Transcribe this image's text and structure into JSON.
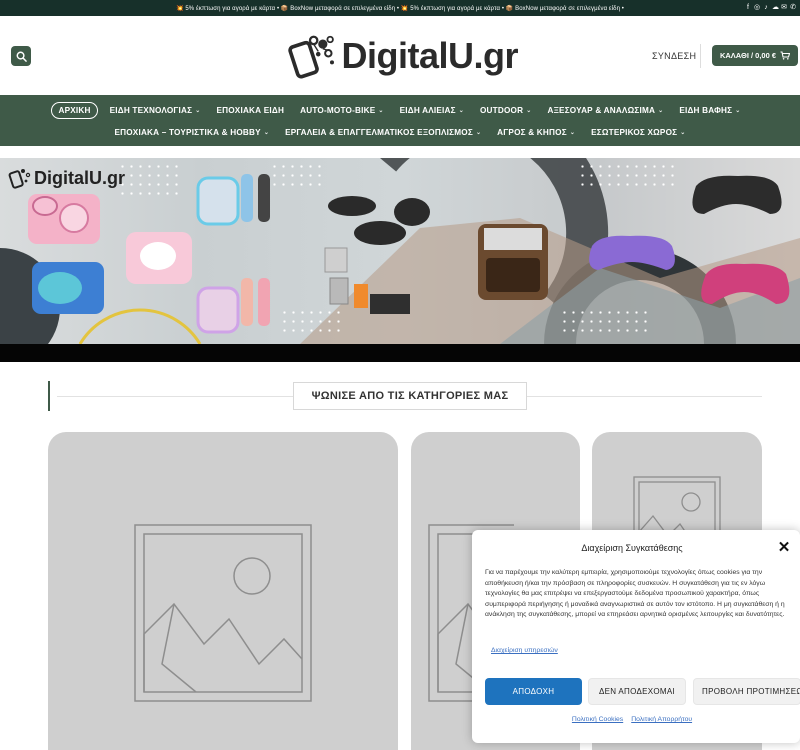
{
  "topbar": {
    "promo": "💥 5% έκπτωση για αγορά με κάρτα • 📦 BoxNow μεταφορά σε επιλεγμένα είδη • 💥 5% έκπτωση για αγορά με κάρτα • 📦 BoxNow μεταφορά σε επιλεγμένα είδη •",
    "social_icons": [
      "facebook-icon",
      "instagram-icon",
      "tiktok-icon",
      "messenger-icon",
      "email-icon",
      "phone-icon"
    ]
  },
  "header": {
    "logo_text": "DigitalU.gr",
    "login_label": "ΣΥΝΔΕΣΗ",
    "cart_label": "ΚΑΛΑΘΙ / 0,00 €"
  },
  "nav": {
    "row1": [
      {
        "label": "ΑΡΧΙΚΗ",
        "active": true,
        "dropdown": false
      },
      {
        "label": "ΕΙΔΗ ΤΕΧΝΟΛΟΓΙΑΣ",
        "dropdown": true
      },
      {
        "label": "ΕΠΟΧΙΑΚΑ ΕΙΔΗ",
        "dropdown": false
      },
      {
        "label": "AUTO-MOTO-BIKE",
        "dropdown": true
      },
      {
        "label": "ΕΙΔΗ ΑΛΙΕΙΑΣ",
        "dropdown": true
      },
      {
        "label": "OUTDOOR",
        "dropdown": true
      },
      {
        "label": "ΑΞΕΣΟΥΑΡ & ΑΝΑΛΩΣΙΜΑ",
        "dropdown": true
      },
      {
        "label": "ΕΙΔΗ ΒΑΦΗΣ",
        "dropdown": true
      }
    ],
    "row2": [
      {
        "label": "ΕΠΟΧΙΑΚΑ – ΤΟΥΡΙΣΤΙΚΑ & HOBBY",
        "dropdown": true
      },
      {
        "label": "ΕΡΓΑΛΕΙΑ & ΕΠΑΓΓΕΛΜΑΤΙΚΟΣ ΕΞΟΠΛΙΣΜΟΣ",
        "dropdown": true
      },
      {
        "label": "ΑΓΡΟΣ & ΚΗΠΟΣ",
        "dropdown": true
      },
      {
        "label": "ΕΣΩΤΕΡΙΚΟΣ ΧΩΡΟΣ",
        "dropdown": true
      }
    ]
  },
  "banner": {
    "logo_text": "DigitalU.gr"
  },
  "section": {
    "title": "ΨΩΝΙΣΕ ΑΠΟ ΤΙΣ ΚΑΤΗΓΟΡΙΕΣ ΜΑΣ"
  },
  "consent": {
    "title": "Διαχείριση Συγκατάθεσης",
    "body": "Για να παρέχουμε την καλύτερη εμπειρία, χρησιμοποιούμε τεχνολογίες όπως cookies για την αποθήκευση ή/και την πρόσβαση σε πληροφορίες συσκευών. Η συγκατάθεση για τις εν λόγω τεχνολογίες θα μας επιτρέψει να επεξεργαστούμε δεδομένα προσωπικού χαρακτήρα, όπως συμπεριφορά περιήγησης ή μοναδικά αναγνωριστικά σε αυτόν τον ιστότοπο. Η μη συγκατάθεση ή η ανάκληση της συγκατάθεσης, μπορεί να επηρεάσει αρνητικά ορισμένες λειτουργίες και δυνατότητες.",
    "manage_link": "Διαχείριση υπηρεσιών",
    "accept": "ΑΠΟΔΟΧΗ",
    "deny": "ΔΕΝ ΑΠΟΔΕΧΟΜΑΙ",
    "preferences": "ΠΡΟΒΟΛΗ ΠΡΟΤΙΜΗΣΕΩΝ",
    "cookie_policy": "Πολιτική Cookies",
    "privacy_policy": "Πολιτική Απορρήτου"
  },
  "colors": {
    "brand_green": "#3f5a48",
    "topbar_dark": "#17302a",
    "accept_blue": "#1e73be",
    "link_blue": "#3a6fc1"
  }
}
